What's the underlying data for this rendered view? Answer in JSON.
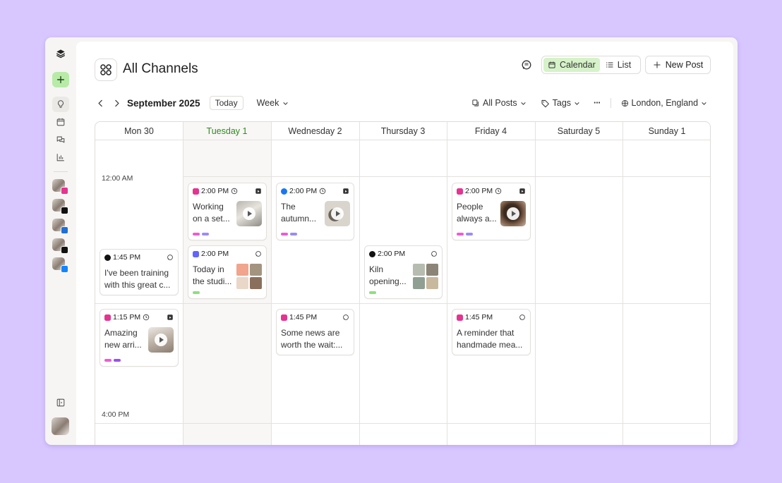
{
  "app": {
    "title": "All Channels"
  },
  "header": {
    "calendar_label": "Calendar",
    "list_label": "List",
    "new_post_label": "New Post"
  },
  "toolbar": {
    "month": "September 2025",
    "today_label": "Today",
    "view_label": "Week",
    "filter_label": "All Posts",
    "tags_label": "Tags",
    "more_label": "···",
    "location_label": "London, England"
  },
  "days": [
    {
      "label": "Mon  30",
      "today": false
    },
    {
      "label": "Tuesday  1",
      "today": true
    },
    {
      "label": "Wednesday  2",
      "today": false
    },
    {
      "label": "Thursday  3",
      "today": false
    },
    {
      "label": "Friday  4",
      "today": false
    },
    {
      "label": "Saturday  5",
      "today": false
    },
    {
      "label": "Sunday  1",
      "today": false
    }
  ],
  "times": [
    "12:00 AM",
    "4:00 PM"
  ],
  "colors": {
    "accent_green": "#d6f2c9",
    "today_text": "#2f8a1f",
    "instagram": "#e6338f",
    "facebook": "#1877f2",
    "tiktok": "#111111",
    "mastodon": "#6364ff",
    "threads": "#111111",
    "bluesky": "#1185fe",
    "tag_pink": "#f05bd3",
    "tag_purple": "#9a8cf7",
    "tag_green": "#8ee07d"
  },
  "sidebar": {
    "icons": [
      "layers-icon",
      "plus-icon",
      "lightbulb-icon",
      "calendar-icon",
      "chat-icon",
      "bar-chart-icon"
    ],
    "accounts": [
      "instagram",
      "threads",
      "linkedin",
      "x",
      "bluesky"
    ]
  },
  "posts": [
    {
      "id": "p1",
      "time": "2:00 PM",
      "network": "instagram",
      "line1": "Working",
      "line2": "on a set...",
      "tags": [
        "pink",
        "purple"
      ]
    },
    {
      "id": "p2",
      "time": "2:00 PM",
      "network": "mastodon",
      "line1": "Today in",
      "line2": "the studi...",
      "tags": [
        "green"
      ]
    },
    {
      "id": "p3",
      "time": "2:00 PM",
      "network": "facebook",
      "line1": "The",
      "line2": "autumn...",
      "tags": [
        "pink",
        "purple"
      ]
    },
    {
      "id": "p4",
      "time": "2:00 PM",
      "network": "threads",
      "line1": "Kiln",
      "line2": "opening...",
      "tags": [
        "green"
      ]
    },
    {
      "id": "p5",
      "time": "2:00 PM",
      "network": "instagram",
      "line1": "People",
      "line2": "always a...",
      "tags": [
        "pink",
        "purple"
      ]
    },
    {
      "id": "p6",
      "time": "1:45 PM",
      "network": "tiktok",
      "line1": "I've been training",
      "line2": "with this great c...",
      "tags": []
    },
    {
      "id": "p7",
      "time": "1:15 PM",
      "network": "instagram",
      "line1": "Amazing",
      "line2": "new arri...",
      "tags": [
        "pink",
        "purple"
      ]
    },
    {
      "id": "p8",
      "time": "1:45 PM",
      "network": "instagram",
      "line1": "Some news are",
      "line2": "worth the wait:...",
      "tags": []
    },
    {
      "id": "p9",
      "time": "1:45 PM",
      "network": "instagram",
      "line1": "A reminder that",
      "line2": "handmade mea...",
      "tags": []
    }
  ]
}
